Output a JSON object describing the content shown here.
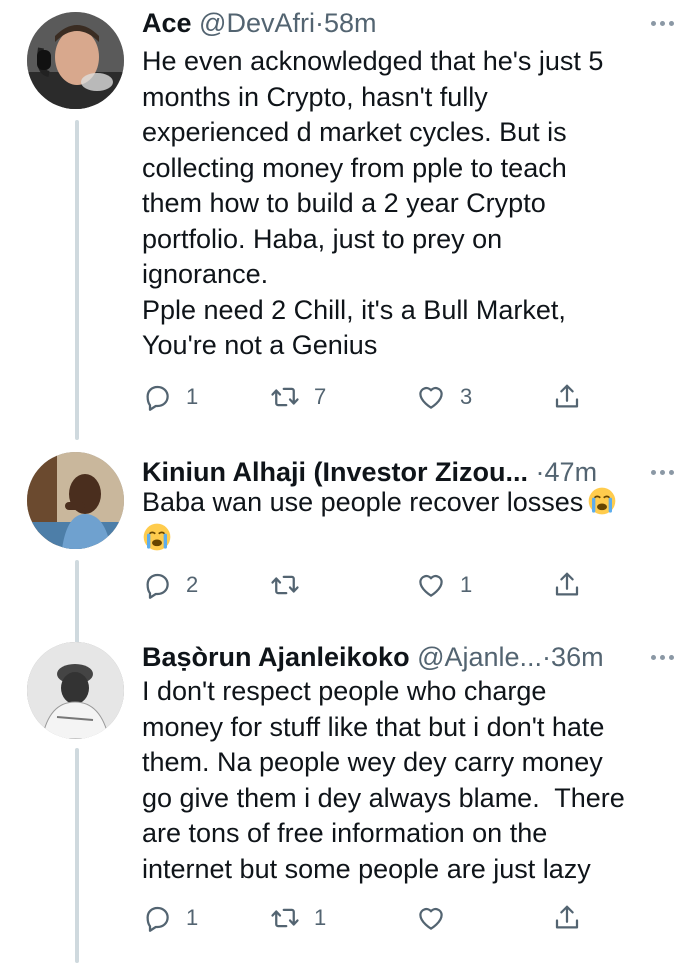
{
  "tweets": [
    {
      "name": "Ace",
      "handle": "@DevAfri",
      "dot": "·",
      "time": "58m",
      "text": "He even acknowledged that he's just 5\nmonths in Crypto, hasn't fully\nexperienced d market cycles. But is\ncollecting money from pple to teach\nthem how to build a 2 year Crypto\nportfolio. Haba, just to prey on\nignorance.\nPple need 2 Chill, it's a Bull Market,\nYou're not a Genius",
      "replies": "1",
      "retweets": "7",
      "likes": "3"
    },
    {
      "name": "Kiniun Alhaji (Investor Zizou...",
      "handle": "",
      "dot": "·",
      "time": "47m",
      "text": "Baba wan use people recover losses",
      "replies": "2",
      "retweets": "",
      "likes": "1"
    },
    {
      "name": "Baṣòrun Ajanleikoko",
      "handle": "@Ajanle...",
      "dot": "·",
      "time": "36m",
      "text": "I don't respect people who charge\nmoney for stuff like that but i don't hate\nthem. Na people wey dey carry money\ngo give them i dey always blame.  There\nare tons of free information on the\ninternet but some people are just lazy",
      "replies": "1",
      "retweets": "1",
      "likes": ""
    }
  ],
  "emoji": {
    "name": "loudly-crying-face",
    "color": "#ffcc4d"
  },
  "colors": {
    "text": "#0f1419",
    "muted": "#536471",
    "thread": "#cfd9de"
  }
}
